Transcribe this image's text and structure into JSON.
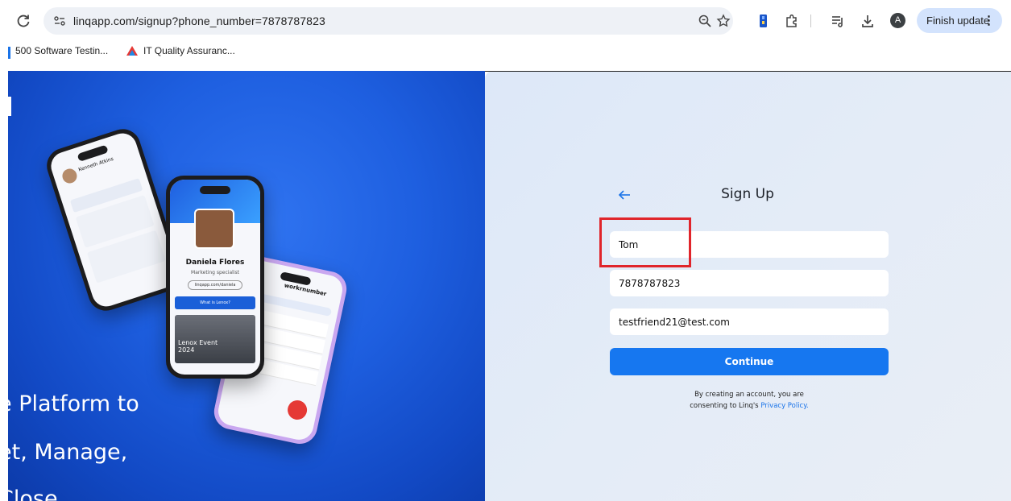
{
  "browser": {
    "url": "linqapp.com/signup?phone_number=7878787823",
    "avatar_letter": "A",
    "finish_update_label": "Finish update",
    "bookmarks": [
      "500 Software Testin...",
      "IT Quality Assuranc..."
    ]
  },
  "hero": {
    "line1": "e Platform to",
    "line2": "et, Manage,",
    "line3": "Close",
    "phone_center": {
      "name": "Daniela Flores",
      "role": "Marketing specialist",
      "link": "linqapp.com/daniela",
      "cta": "What is Lenox?",
      "event": "Lenox Event 2024"
    },
    "phone_left": {
      "name": "Kenneth Atkins"
    },
    "phone_right": {
      "header": "workrnumber"
    }
  },
  "form": {
    "title": "Sign Up",
    "name_value": "Tom",
    "phone_value": "7878787823",
    "email_value": "testfriend21@test.com",
    "continue_label": "Continue",
    "consent_line1": "By creating an account, you are",
    "consent_line2_prefix": "consenting to Linq's ",
    "privacy_link": "Privacy Policy."
  },
  "colors": {
    "primary": "#1677f0",
    "hero_blue": "#1e5fe0",
    "highlight": "#e0252b"
  }
}
